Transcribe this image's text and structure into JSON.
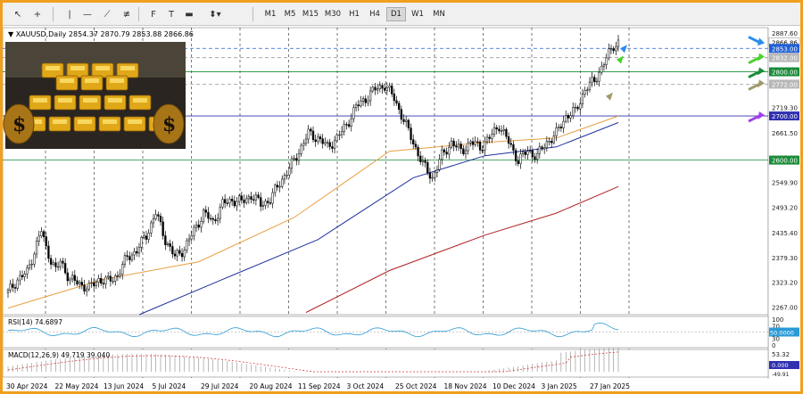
{
  "toolbar": {
    "tools": [
      {
        "name": "cursor-icon",
        "glyph": "↖"
      },
      {
        "name": "crosshair-icon",
        "glyph": "+"
      },
      {
        "name": "vertical-line-icon",
        "glyph": "|"
      },
      {
        "name": "horizontal-line-icon",
        "glyph": "—"
      },
      {
        "name": "trendline-icon",
        "glyph": "⟋"
      },
      {
        "name": "equidistant-channel-icon",
        "glyph": "≢"
      },
      {
        "name": "fibonacci-icon",
        "glyph": "F"
      },
      {
        "name": "text-label-icon",
        "glyph": "T"
      },
      {
        "name": "shape-rectangle-icon",
        "glyph": "▬"
      },
      {
        "name": "arrows-dropdown-icon",
        "glyph": "⬍▾"
      }
    ],
    "timeframes": [
      "M1",
      "M5",
      "M15",
      "M30",
      "H1",
      "H4",
      "D1",
      "W1",
      "MN"
    ],
    "active_timeframe": "D1"
  },
  "chart_data": {
    "type": "candlestick",
    "symbol_line": "XAUUSD,Daily  2854.37 2870.79 2853.88 2866.86",
    "symbol": "XAUUSD,Daily",
    "ohlc": {
      "open": 2854.37,
      "high": 2870.79,
      "low": 2853.88,
      "close": 2866.86
    },
    "price_axis": {
      "ticks": [
        "2887.60",
        "2860.40",
        "2832.00",
        "2800.00",
        "2772.00",
        "2719.30",
        "2661.50",
        "2605.90",
        "2549.90",
        "2493.20",
        "2435.40",
        "2379.30",
        "2323.20",
        "2267.00"
      ],
      "ylim": [
        2250,
        2900
      ]
    },
    "price_labels": [
      {
        "value": 2866.86,
        "text": "2866.86",
        "bg": "#ffffff",
        "fg": "#000000"
      },
      {
        "value": 2853.0,
        "text": "2853.00",
        "bg": "#1f5fd6",
        "fg": "#ffffff"
      },
      {
        "value": 2832.0,
        "text": "2832.00",
        "bg": "#b7b7b7",
        "fg": "#ffffff"
      },
      {
        "value": 2800.0,
        "text": "2800.00",
        "bg": "#1a8c3a",
        "fg": "#ffffff"
      },
      {
        "value": 2772.0,
        "text": "2772.00",
        "bg": "#b7b7b7",
        "fg": "#ffffff"
      },
      {
        "value": 2700.0,
        "text": "2700.00",
        "bg": "#3030b0",
        "fg": "#ffffff"
      },
      {
        "value": 2600.0,
        "text": "2600.00",
        "bg": "#1a8c3a",
        "fg": "#ffffff"
      }
    ],
    "hlines": [
      {
        "value": 2853.0,
        "color": "#1f5fd6",
        "style": "dashed"
      },
      {
        "value": 2832.0,
        "color": "#999999",
        "style": "dashed"
      },
      {
        "value": 2800.0,
        "color": "#1a8c3a",
        "style": "solid"
      },
      {
        "value": 2772.0,
        "color": "#999999",
        "style": "dashed"
      },
      {
        "value": 2700.0,
        "color": "#3030b0",
        "style": "solid"
      },
      {
        "value": 2600.0,
        "color": "#1a8c3a",
        "style": "solid"
      }
    ],
    "x_labels": [
      "30 Apr 2024",
      "22 May 2024",
      "13 Jun 2024",
      "5 Jul 2024",
      "29 Jul 2024",
      "20 Aug 2024",
      "11 Sep 2024",
      "3 Oct 2024",
      "25 Oct 2024",
      "18 Nov 2024",
      "10 Dec 2024",
      "3 Jan 2025",
      "27 Jan 2025"
    ],
    "close_path": [
      [
        0,
        2300
      ],
      [
        4,
        2330
      ],
      [
        8,
        2345
      ],
      [
        12,
        2410
      ],
      [
        14,
        2440
      ],
      [
        16,
        2400
      ],
      [
        20,
        2350
      ],
      [
        22,
        2370
      ],
      [
        26,
        2330
      ],
      [
        30,
        2320
      ],
      [
        34,
        2310
      ],
      [
        38,
        2330
      ],
      [
        42,
        2325
      ],
      [
        46,
        2340
      ],
      [
        50,
        2380
      ],
      [
        54,
        2395
      ],
      [
        58,
        2430
      ],
      [
        62,
        2480
      ],
      [
        66,
        2420
      ],
      [
        70,
        2380
      ],
      [
        74,
        2400
      ],
      [
        78,
        2440
      ],
      [
        82,
        2480
      ],
      [
        86,
        2460
      ],
      [
        90,
        2500
      ],
      [
        94,
        2510
      ],
      [
        98,
        2505
      ],
      [
        102,
        2520
      ],
      [
        106,
        2500
      ],
      [
        110,
        2510
      ],
      [
        114,
        2550
      ],
      [
        118,
        2580
      ],
      [
        122,
        2620
      ],
      [
        126,
        2660
      ],
      [
        130,
        2650
      ],
      [
        134,
        2630
      ],
      [
        138,
        2650
      ],
      [
        142,
        2680
      ],
      [
        146,
        2720
      ],
      [
        150,
        2740
      ],
      [
        154,
        2760
      ],
      [
        158,
        2770
      ],
      [
        162,
        2740
      ],
      [
        166,
        2690
      ],
      [
        170,
        2640
      ],
      [
        174,
        2590
      ],
      [
        178,
        2560
      ],
      [
        182,
        2610
      ],
      [
        186,
        2640
      ],
      [
        190,
        2620
      ],
      [
        194,
        2640
      ],
      [
        198,
        2630
      ],
      [
        202,
        2650
      ],
      [
        206,
        2680
      ],
      [
        210,
        2640
      ],
      [
        214,
        2600
      ],
      [
        218,
        2620
      ],
      [
        222,
        2610
      ],
      [
        226,
        2640
      ],
      [
        230,
        2660
      ],
      [
        234,
        2700
      ],
      [
        238,
        2710
      ],
      [
        242,
        2760
      ],
      [
        246,
        2780
      ],
      [
        250,
        2820
      ],
      [
        254,
        2860
      ],
      [
        256,
        2866.86
      ]
    ],
    "ma_series": [
      {
        "name": "MA50",
        "color": "#e8a040",
        "points": [
          [
            0,
            2265
          ],
          [
            40,
            2330
          ],
          [
            80,
            2370
          ],
          [
            120,
            2470
          ],
          [
            160,
            2620
          ],
          [
            200,
            2640
          ],
          [
            230,
            2650
          ],
          [
            256,
            2700
          ]
        ]
      },
      {
        "name": "MA100",
        "color": "#2030a0",
        "points": [
          [
            55,
            2250
          ],
          [
            90,
            2330
          ],
          [
            130,
            2420
          ],
          [
            170,
            2560
          ],
          [
            200,
            2610
          ],
          [
            230,
            2630
          ],
          [
            256,
            2685
          ]
        ]
      },
      {
        "name": "MA200",
        "color": "#b02020",
        "points": [
          [
            125,
            2255
          ],
          [
            160,
            2350
          ],
          [
            200,
            2430
          ],
          [
            230,
            2480
          ],
          [
            256,
            2540
          ]
        ]
      }
    ],
    "trade_arrows": [
      {
        "value": 2866.86,
        "color": "#2a8cf0",
        "name": "blue-arrow-icon"
      },
      {
        "value": 2832.0,
        "color": "#4cd132",
        "name": "lime-arrow-icon"
      },
      {
        "value": 2800.0,
        "color": "#1a8c3a",
        "name": "green-arrow-icon"
      },
      {
        "value": 2772.0,
        "color": "#a09a6a",
        "name": "khaki-arrow-icon"
      },
      {
        "value": 2700.0,
        "color": "#a040f0",
        "name": "purple-arrow-icon"
      }
    ],
    "rsi": {
      "label": "RSI(14) 74.6897",
      "levels": [
        "100",
        "70",
        "50.0000",
        "30",
        "0"
      ],
      "value": 74.6897
    },
    "macd": {
      "label": "MACD(12,26,9) 49.719 39.040",
      "levels": [
        "53.32",
        "0.000",
        "-49.91"
      ],
      "main": 49.719,
      "signal": 39.04
    }
  }
}
